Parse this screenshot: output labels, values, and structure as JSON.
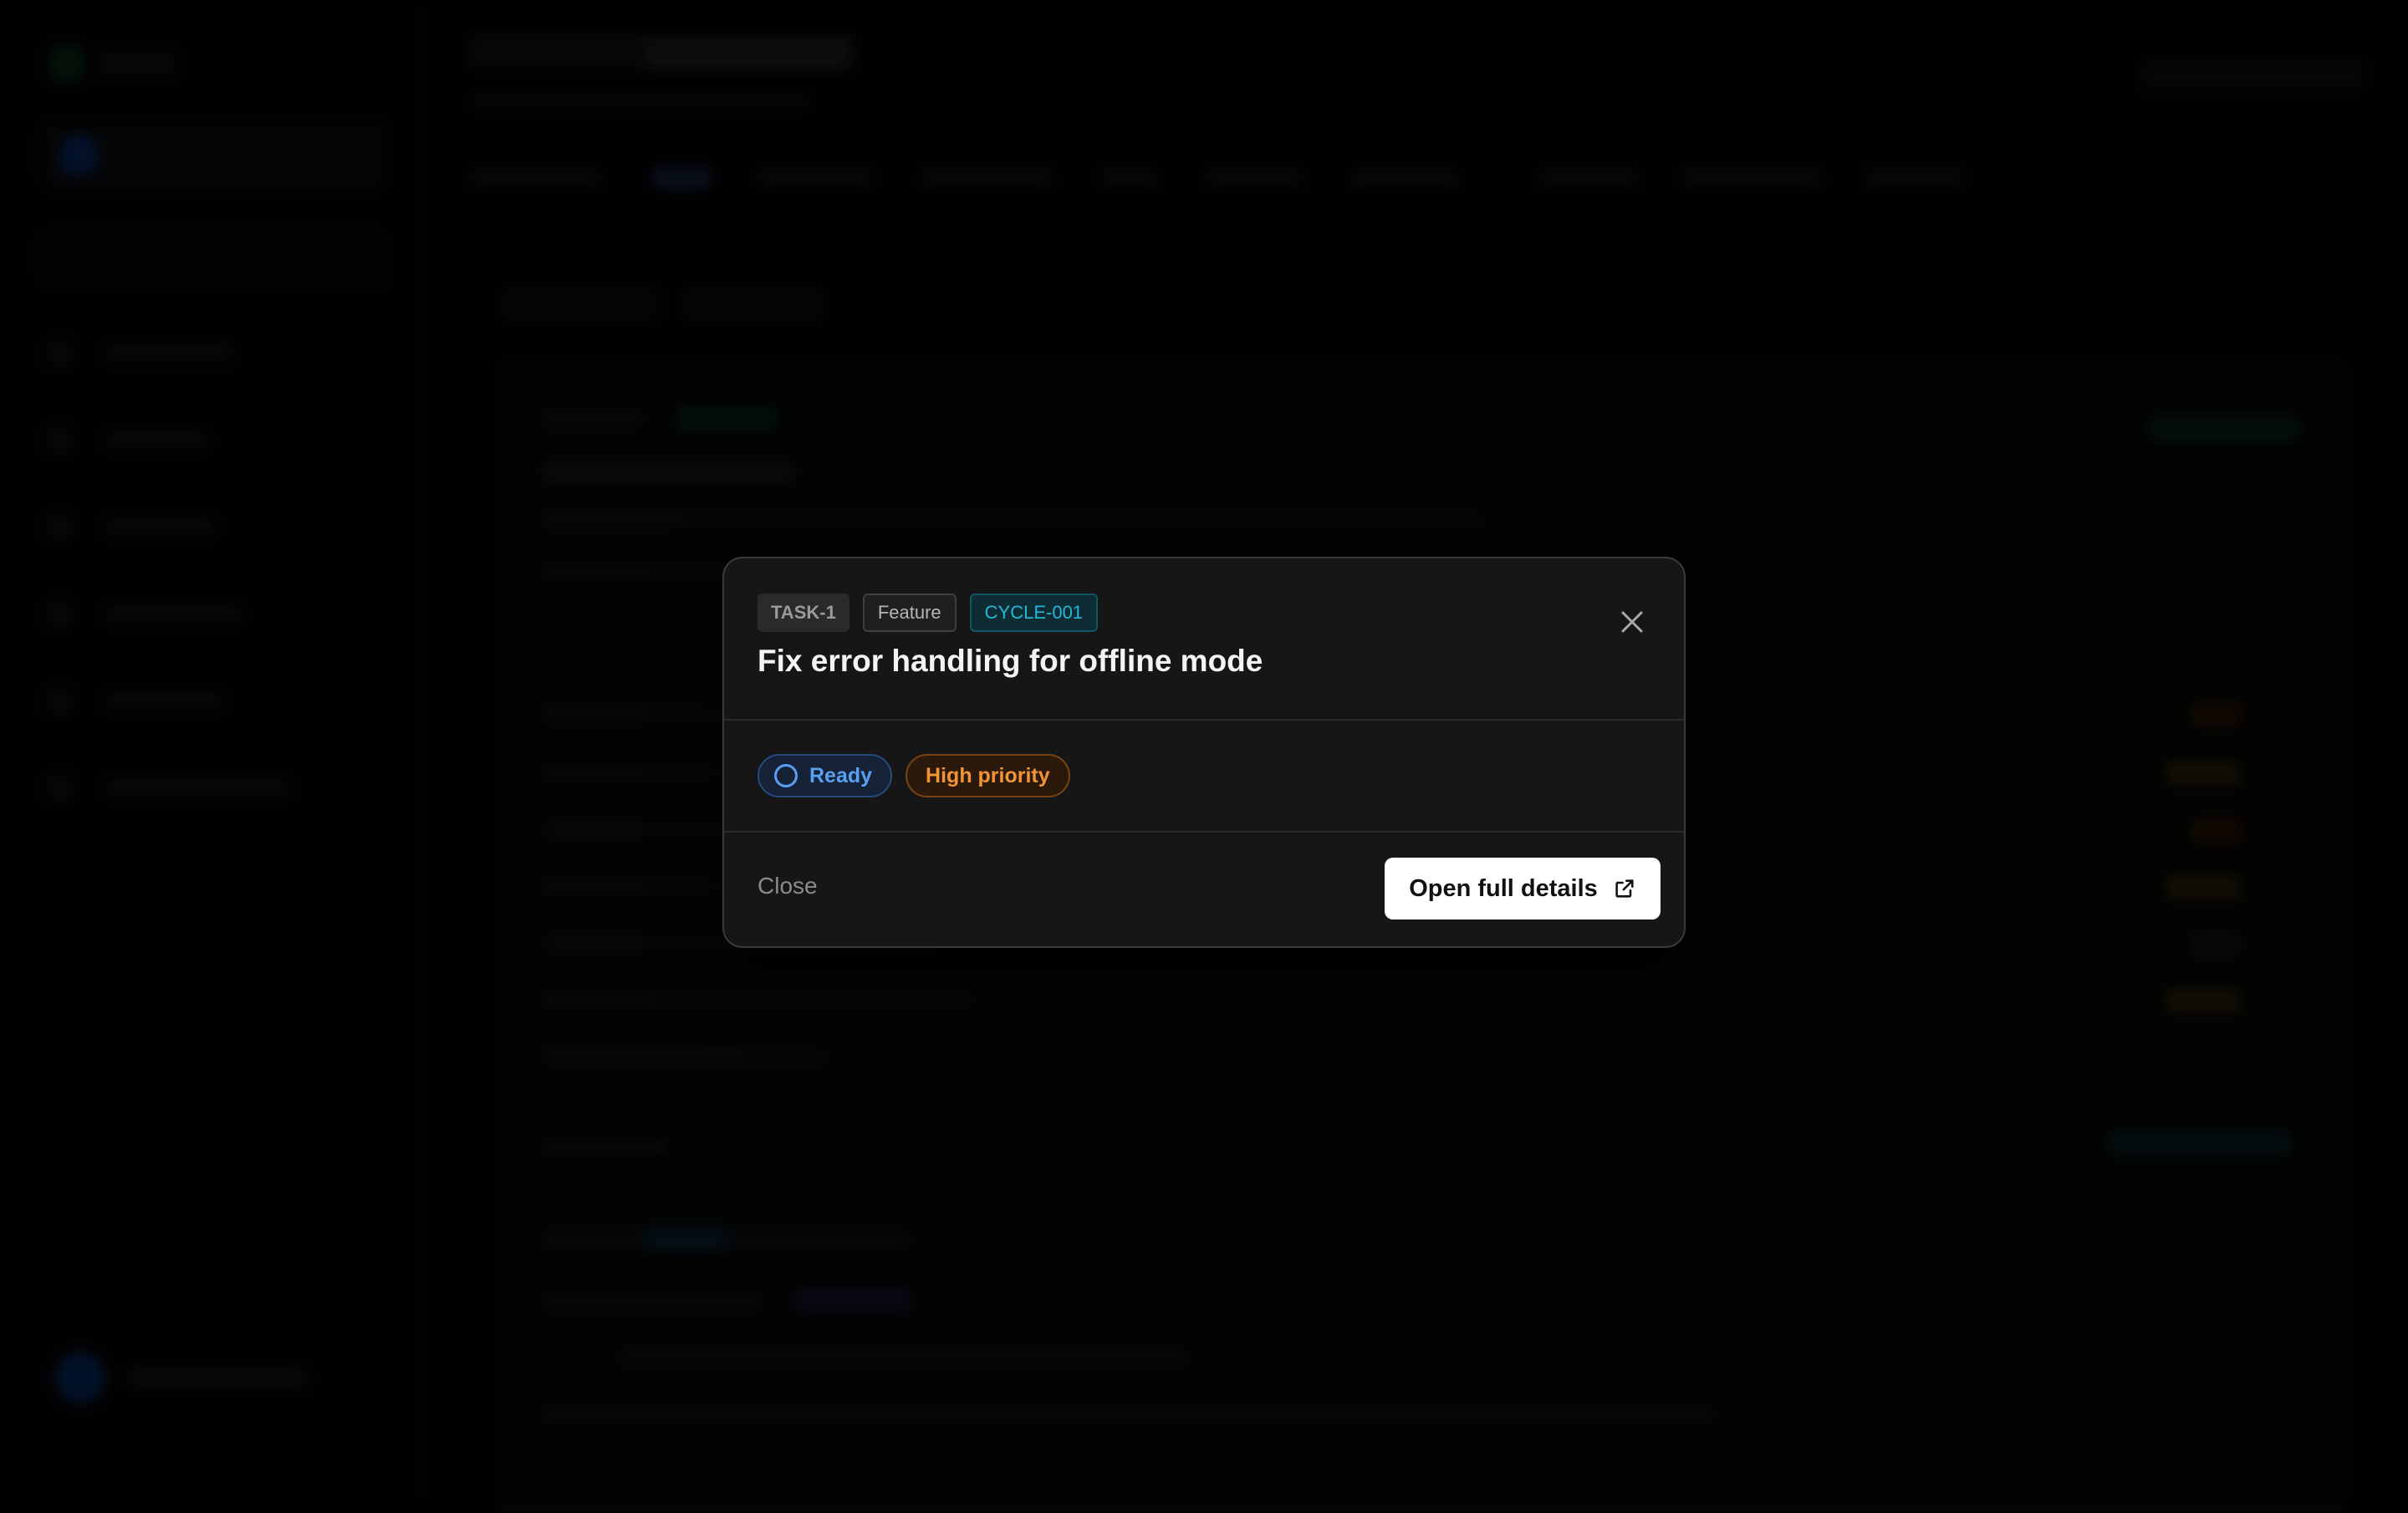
{
  "modal": {
    "task_id": "TASK-1",
    "type": "Feature",
    "cycle": "CYCLE-001",
    "title": "Fix error handling for offline mode",
    "status": "Ready",
    "priority": "High priority",
    "close_label": "Close",
    "open_label": "Open full details",
    "icons": {
      "close": "close-icon",
      "status": "circle-status-icon",
      "open": "external-link-icon"
    }
  },
  "colors": {
    "status_blue": "#5aa0f0",
    "priority_orange": "#f19434",
    "cycle_cyan": "#22b8d8",
    "modal_bg": "#161616"
  }
}
